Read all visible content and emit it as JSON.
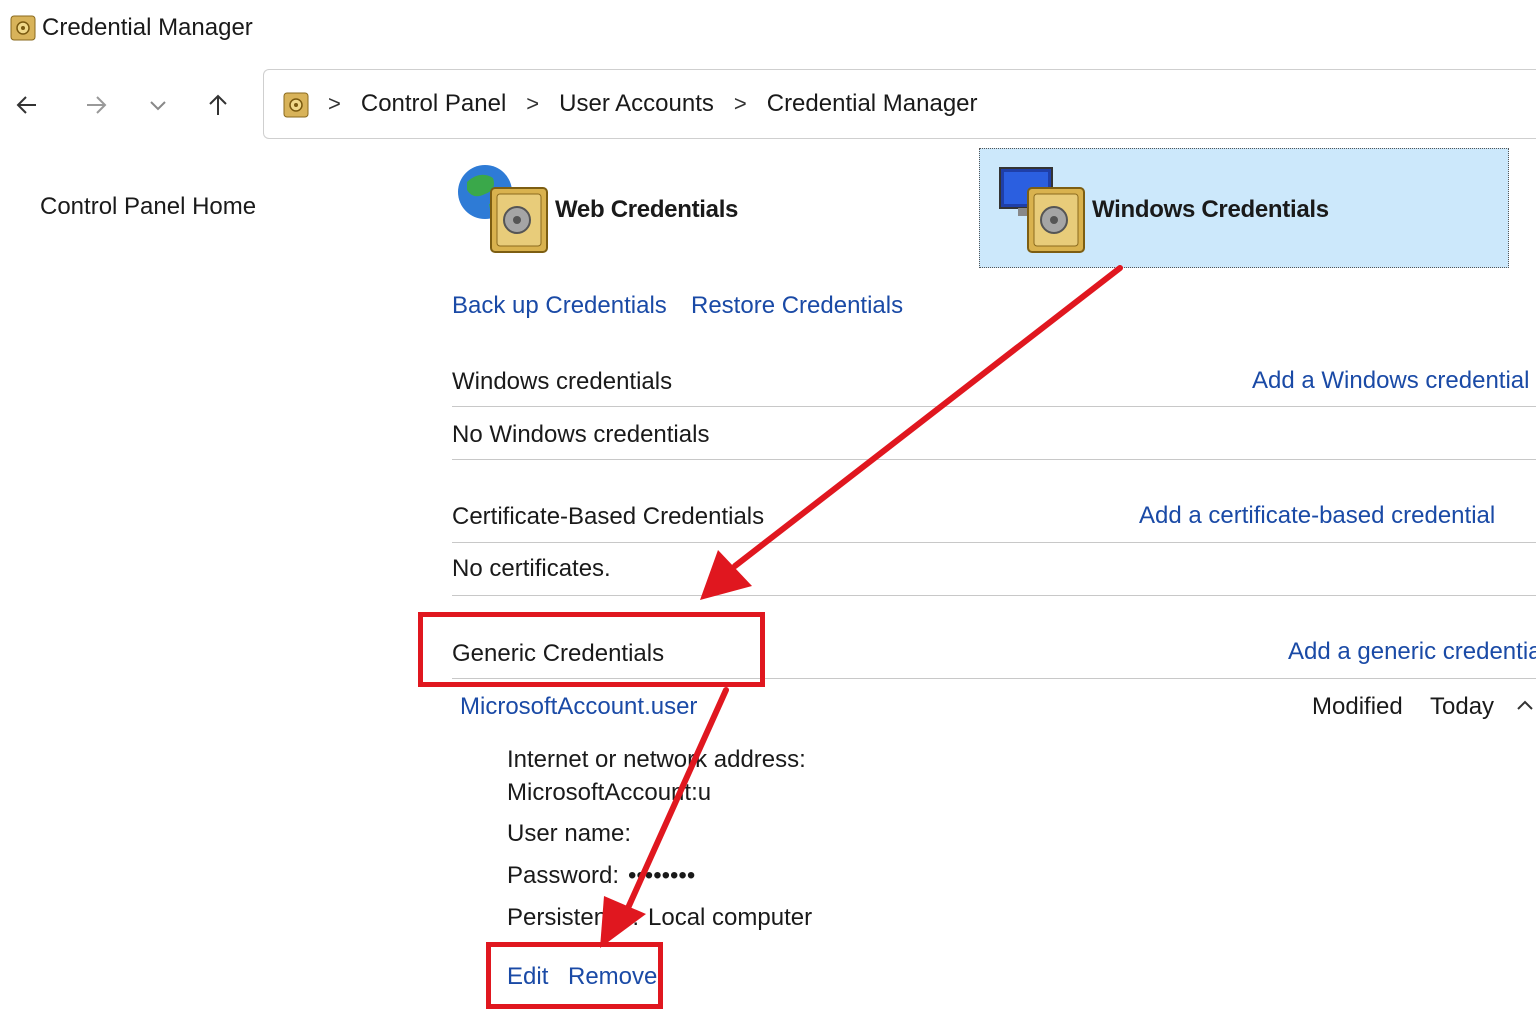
{
  "window": {
    "title": "Credential Manager"
  },
  "nav": {
    "back_icon": "arrow-left-icon",
    "forward_icon": "arrow-right-icon",
    "recent_icon": "chevron-down-icon",
    "up_icon": "arrow-up-icon"
  },
  "breadcrumb": {
    "separator": ">",
    "items": [
      "Control Panel",
      "User Accounts",
      "Credential Manager"
    ]
  },
  "sidebar": {
    "home_link": "Control Panel Home"
  },
  "tiles": {
    "web": "Web Credentials",
    "windows": "Windows Credentials"
  },
  "actions": {
    "backup": "Back up Credentials",
    "restore": "Restore Credentials"
  },
  "sections": {
    "windows": {
      "heading": "Windows credentials",
      "add_link": "Add a Windows credential",
      "empty": "No Windows credentials"
    },
    "certificate": {
      "heading": "Certificate-Based Credentials",
      "add_link": "Add a certificate-based credential",
      "empty": "No certificates."
    },
    "generic": {
      "heading": "Generic Credentials",
      "add_link": "Add a generic credential"
    }
  },
  "credential": {
    "name": "MicrosoftAccount.user",
    "modified_label": "Modified",
    "modified_value": "Today",
    "address_label": "Internet or network address:",
    "address_value": "MicrosoftAccount:u",
    "username_label": "User name:",
    "password_label": "Password:",
    "password_value": "••••••••",
    "persistence_label": "Persistence:",
    "persistence_value": "Local computer",
    "edit_link": "Edit",
    "remove_link": "Remove"
  },
  "colors": {
    "link": "#1a4aa6",
    "selected_tile": "#cce8fb",
    "annotation_red": "#e0171f"
  }
}
